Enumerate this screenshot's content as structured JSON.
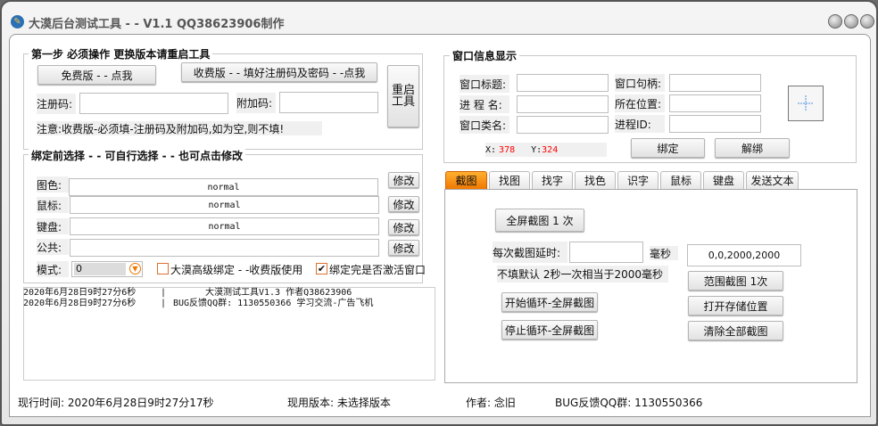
{
  "window": {
    "title": "大漠后台测试工具 - - V1.1  QQ38623906制作"
  },
  "step1": {
    "title": "第一步 必须操作  更换版本请重启工具",
    "free_btn": "免费版 - - 点我",
    "paid_btn": "收费版 - - 填好注册码及密码 - -点我",
    "restart_btn": "重启工具",
    "reg_label": "注册码:",
    "reg_value": "",
    "extra_label": "附加码:",
    "extra_value": "",
    "note": "注意:收费版-必须填-注册码及附加码,如为空,则不填!"
  },
  "bind": {
    "title": "绑定前选择 - - 可自行选择 - - 也可点击修改",
    "rows": [
      {
        "label": "图色:",
        "value": "normal",
        "btn": "修改"
      },
      {
        "label": "鼠标:",
        "value": "normal",
        "btn": "修改"
      },
      {
        "label": "键盘:",
        "value": "normal",
        "btn": "修改"
      },
      {
        "label": "公共:",
        "value": "",
        "btn": "修改"
      }
    ],
    "mode_label": "模式:",
    "mode_value": "0",
    "adv_label": "大漠高级绑定 - -收费版使用",
    "adv_checked": false,
    "activate_label": "绑定完是否激活窗口",
    "activate_checked": true
  },
  "log": {
    "lines": [
      {
        "time": "2020年6月28日9时27分6秒",
        "msg": "大漠测试工具V1.3 作者Q38623906"
      },
      {
        "time": "2020年6月28日9时27分6秒",
        "msg": "BUG反馈QQ群: 1130550366  学习交流-广告飞机"
      }
    ]
  },
  "wininfo": {
    "title": "窗口信息显示",
    "win_title_label": "窗口标题:",
    "proc_label": "进 程 名:",
    "class_label": "窗口类名:",
    "handle_label": "窗口句柄:",
    "location_label": "所在位置:",
    "pid_label": "进程ID:",
    "x_label": "X:",
    "x_value": "378",
    "y_label": "Y:",
    "y_value": "324",
    "bind_btn": "绑定",
    "unbind_btn": "解绑"
  },
  "tabs": [
    {
      "label": "截图",
      "active": true
    },
    {
      "label": "找图"
    },
    {
      "label": "找字"
    },
    {
      "label": "找色"
    },
    {
      "label": "识字"
    },
    {
      "label": "鼠标"
    },
    {
      "label": "键盘"
    },
    {
      "label": "发送文本"
    }
  ],
  "shot": {
    "full_btn": "全屏截图 1 次",
    "delay_label": "每次截图延时:",
    "delay_value": "",
    "ms_label": "毫秒",
    "range_value": "0,0,2000,2000",
    "hint": "不填默认 2秒一次相当于2000毫秒",
    "range_btn": "范围截图 1次",
    "open_btn": "打开存储位置",
    "clear_btn": "清除全部截图",
    "start_btn": "开始循环-全屏截图",
    "stop_btn": "停止循环-全屏截图"
  },
  "status": {
    "time": "现行时间: 2020年6月28日9时27分17秒",
    "version": "现用版本: 未选择版本",
    "author": "作者: 念旧",
    "qq": "BUG反馈QQ群: 1130550366"
  },
  "colors": {
    "accent": "#f07800",
    "coord": "#ff0000"
  }
}
